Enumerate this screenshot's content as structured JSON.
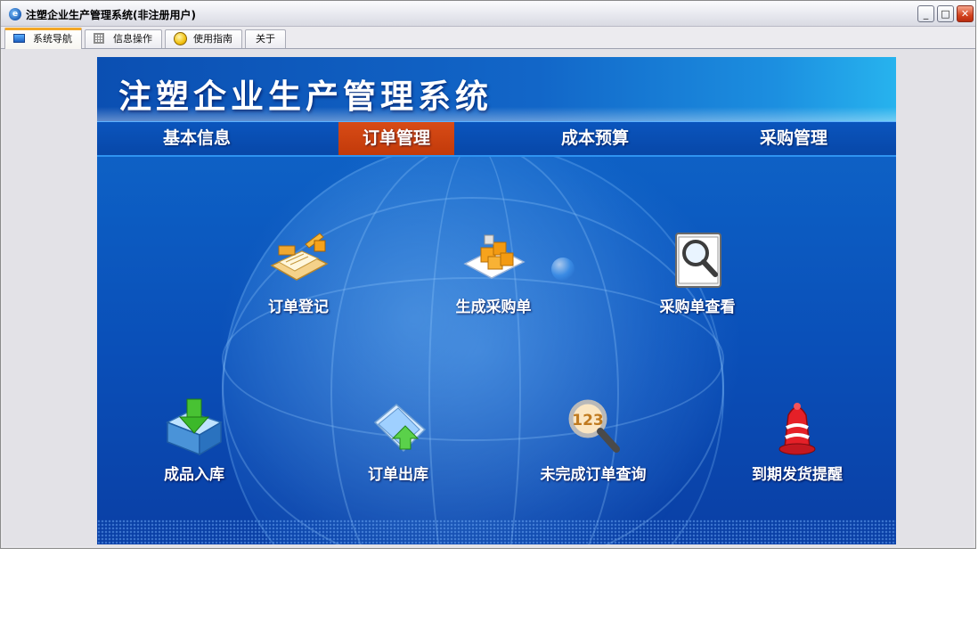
{
  "window": {
    "title": "注塑企业生产管理系统(非注册用户)",
    "controls": {
      "minimize": "_",
      "restore": "□",
      "close": "✕"
    }
  },
  "tabs": [
    {
      "label": "系统导航",
      "icon": "monitor-icon",
      "active": true
    },
    {
      "label": "信息操作",
      "icon": "grid-icon",
      "active": false
    },
    {
      "label": "使用指南",
      "icon": "help-icon",
      "active": false
    },
    {
      "label": "关于",
      "icon": "",
      "active": false
    }
  ],
  "banner": {
    "title": "注塑企业生产管理系统",
    "nav": [
      "基本信息",
      "订单管理",
      "成本预算",
      "采购管理"
    ],
    "active_nav": "订单管理"
  },
  "functions": [
    {
      "label": "订单登记",
      "icon": "order-register-icon"
    },
    {
      "label": "生成采购单",
      "icon": "generate-purchase-icon"
    },
    {
      "label": "采购单查看",
      "icon": "purchase-view-icon"
    },
    {
      "label": "成品入库",
      "icon": "stock-in-icon"
    },
    {
      "label": "订单出库",
      "icon": "order-out-icon"
    },
    {
      "label": "未完成订单查询",
      "icon": "unfinished-query-icon"
    },
    {
      "label": "到期发货提醒",
      "icon": "due-alarm-icon"
    }
  ],
  "colors": {
    "accent_tab": "#f3a728",
    "nav_active": "#c8400e",
    "banner_blue": "#0d5fc4"
  }
}
